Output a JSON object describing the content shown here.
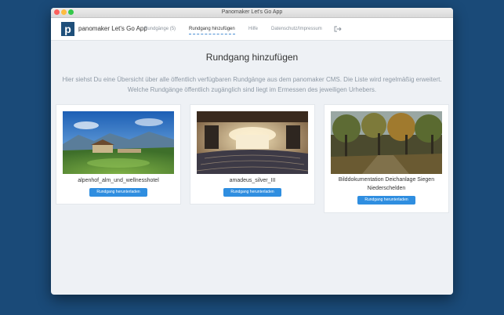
{
  "window": {
    "title": "Panomaker Let's Go App"
  },
  "header": {
    "logo_letter": "p",
    "brand": "panomaker Let's Go App",
    "nav": [
      {
        "label": "Rundgänge (5)",
        "active": false
      },
      {
        "label": "Rundgang hinzufügen",
        "active": true
      },
      {
        "label": "Hilfe",
        "active": false
      },
      {
        "label": "Datenschutz/Impressum",
        "active": false
      }
    ],
    "extra_icon": "logout-icon"
  },
  "main": {
    "title": "Rundgang hinzufügen",
    "intro": "Hier siehst Du eine Übersicht über alle öffentlich verfügbaren Rundgänge aus dem panomaker CMS. Die Liste wird regelmäßig erweitert. Welche Rundgänge öffentlich zugänglich sind liegt im Ermessen des jeweiligen Urhebers.",
    "tours": [
      {
        "name": "alpenhof_alm_und_wellnesshotel",
        "button": "Rundgang herunterladen"
      },
      {
        "name": "amadeus_silver_III",
        "button": "Rundgang herunterladen"
      },
      {
        "name": "Bilddokumentation Deichanlage Siegen Niederschelden",
        "button": "Rundgang herunterladen"
      }
    ]
  },
  "colors": {
    "desktop": "#1a4a78",
    "accent": "#2f8ee0",
    "logo": "#1f4f7a"
  }
}
